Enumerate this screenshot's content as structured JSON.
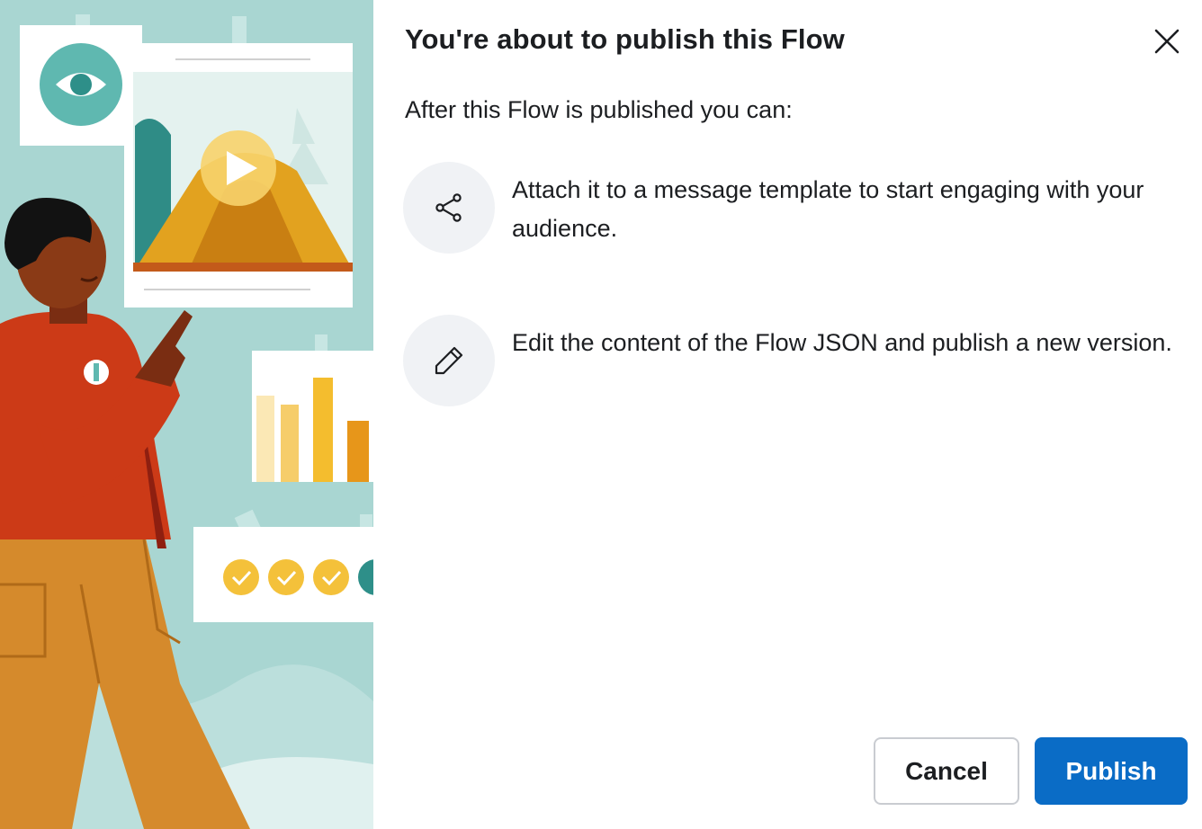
{
  "dialog": {
    "title": "You're about to publish this Flow",
    "subtitle": "After this Flow is published you can:",
    "features": [
      {
        "icon": "share-icon",
        "text": "Attach it to a message template to start engaging with your audience."
      },
      {
        "icon": "pencil-icon",
        "text": "Edit the content of the Flow JSON and publish a new version."
      }
    ],
    "buttons": {
      "cancel_label": "Cancel",
      "publish_label": "Publish"
    }
  },
  "colors": {
    "primary": "#0a6cc6",
    "illustration_bg": "#a9d6d2",
    "icon_circle": "#f0f2f5"
  },
  "illustration": {
    "icons": [
      "eye-icon",
      "play-icon",
      "check-icon"
    ]
  }
}
